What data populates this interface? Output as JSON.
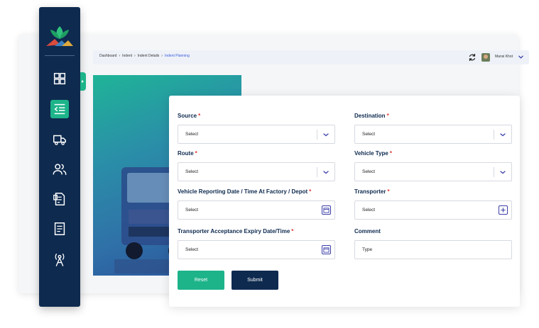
{
  "breadcrumb": [
    "Dashboard",
    "Indent",
    "Indent Details",
    "Indent Planning"
  ],
  "user": {
    "name": "Mansi Khot"
  },
  "sidebar": {
    "items": [
      {
        "icon": "dashboard-grid-icon",
        "active": false
      },
      {
        "icon": "indent-list-icon",
        "active": true
      },
      {
        "icon": "truck-icon",
        "active": false
      },
      {
        "icon": "users-icon",
        "active": false
      },
      {
        "icon": "invoice-icon",
        "active": false
      },
      {
        "icon": "document-icon",
        "active": false
      },
      {
        "icon": "tower-icon",
        "active": false
      }
    ]
  },
  "form": {
    "source": {
      "label": "Source",
      "value": "Select"
    },
    "destination": {
      "label": "Destination",
      "value": "Select"
    },
    "route": {
      "label": "Route",
      "value": "Select"
    },
    "vehicle_type": {
      "label": "Vehicle Type",
      "value": "Select"
    },
    "reporting": {
      "label": "Vehicle Reporting Date / Time At Factory / Depot",
      "value": "Select"
    },
    "transporter": {
      "label": "Transporter",
      "value": "Select"
    },
    "acceptance": {
      "label": "Transporter Acceptance Expiry Date/Time",
      "value": "Select"
    },
    "comment": {
      "label": "Comment",
      "placeholder": "Type"
    },
    "required_mark": "*",
    "reset_label": "Reset",
    "submit_label": "Submit"
  },
  "colors": {
    "navy": "#0e2a4f",
    "green": "#1db48a",
    "required": "#e0342f",
    "link": "#3b5bdb"
  }
}
